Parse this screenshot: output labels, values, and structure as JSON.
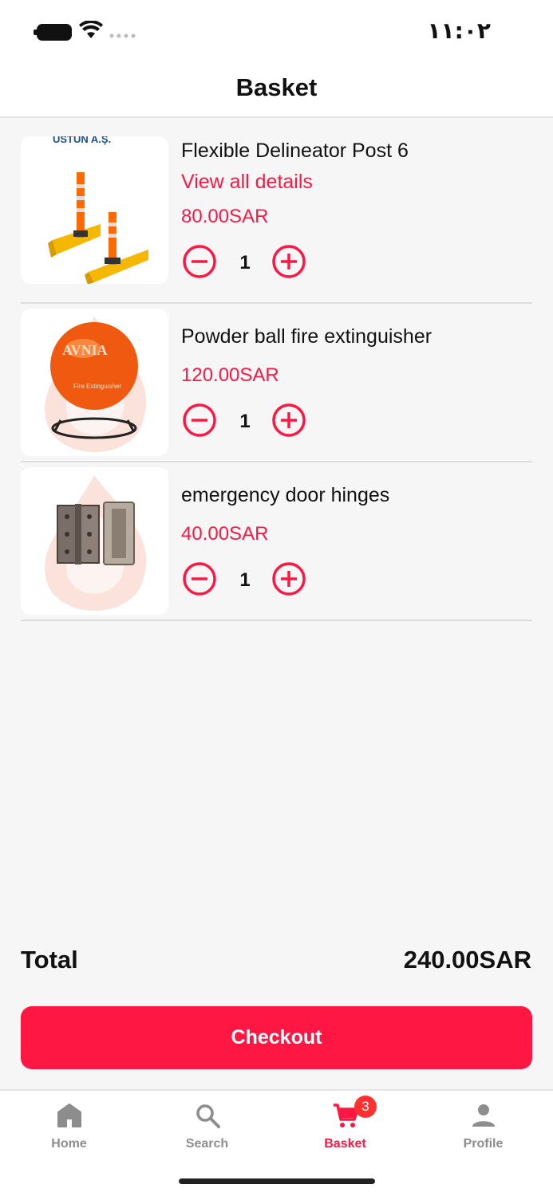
{
  "status_bar": {
    "time": "١١:٠٢"
  },
  "nav": {
    "title": "Basket"
  },
  "cart_items": [
    {
      "name": "Flexible Delineator Post 6",
      "details_link": "View all details",
      "price": "80.00SAR",
      "quantity": "1",
      "image_caption": "USTUN A.Ş."
    },
    {
      "name": "Powder ball fire extinguisher",
      "price": "120.00SAR",
      "quantity": "1"
    },
    {
      "name": "emergency door hinges",
      "price": "40.00SAR",
      "quantity": "1"
    }
  ],
  "summary": {
    "total_label": "Total",
    "total_value": "240.00SAR"
  },
  "checkout": {
    "label": "Checkout"
  },
  "tab_bar": {
    "tabs": [
      {
        "label": "Home",
        "icon": "home-icon"
      },
      {
        "label": "Search",
        "icon": "search-icon"
      },
      {
        "label": "Basket",
        "icon": "cart-icon",
        "badge": "3",
        "active": true
      },
      {
        "label": "Profile",
        "icon": "profile-icon"
      }
    ]
  },
  "colors": {
    "accent": "#ff1744",
    "badge": "#ff3030",
    "inactive_tab": "#8d8d8d",
    "background": "#f6f6f6"
  }
}
